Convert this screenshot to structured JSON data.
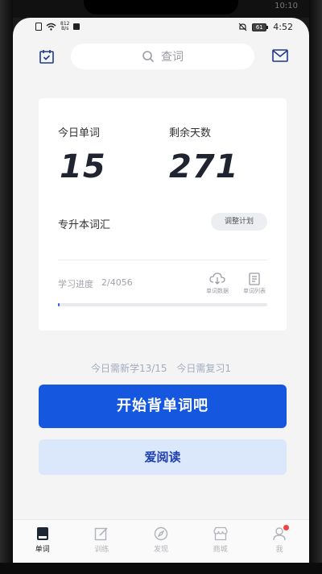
{
  "status_bar": {
    "net_speed_value": "812",
    "net_speed_unit": "B/s",
    "battery": "61",
    "time": "4:52",
    "frame_time": "10:10"
  },
  "header": {
    "search_placeholder": "查词"
  },
  "card": {
    "today_words_label": "今日单词",
    "today_words_value": "15",
    "days_left_label": "剩余天数",
    "days_left_value": "271",
    "plan_name": "专升本词汇",
    "adjust_plan": "调整计划",
    "progress_label": "学习进度",
    "progress_value": "2/4056",
    "progress_fraction": 0.0005,
    "tools": [
      {
        "label": "单词数据",
        "icon": "cloud-download-icon"
      },
      {
        "label": "单词列表",
        "icon": "list-doc-icon"
      }
    ]
  },
  "summary": {
    "new_words": "今日需新学13/15",
    "review": "今日需复习1"
  },
  "actions": {
    "start": "开始背单词吧",
    "read": "爱阅读"
  },
  "nav": {
    "items": [
      {
        "label": "单词",
        "icon": "book-icon",
        "active": true
      },
      {
        "label": "训练",
        "icon": "edit-icon",
        "active": false
      },
      {
        "label": "发现",
        "icon": "compass-icon",
        "active": false
      },
      {
        "label": "商城",
        "icon": "store-icon",
        "active": false
      },
      {
        "label": "我",
        "icon": "person-icon",
        "active": false
      }
    ]
  },
  "colors": {
    "primary": "#1657e0",
    "secondary_bg": "#dbe7fa",
    "badge": "#ef4444"
  }
}
